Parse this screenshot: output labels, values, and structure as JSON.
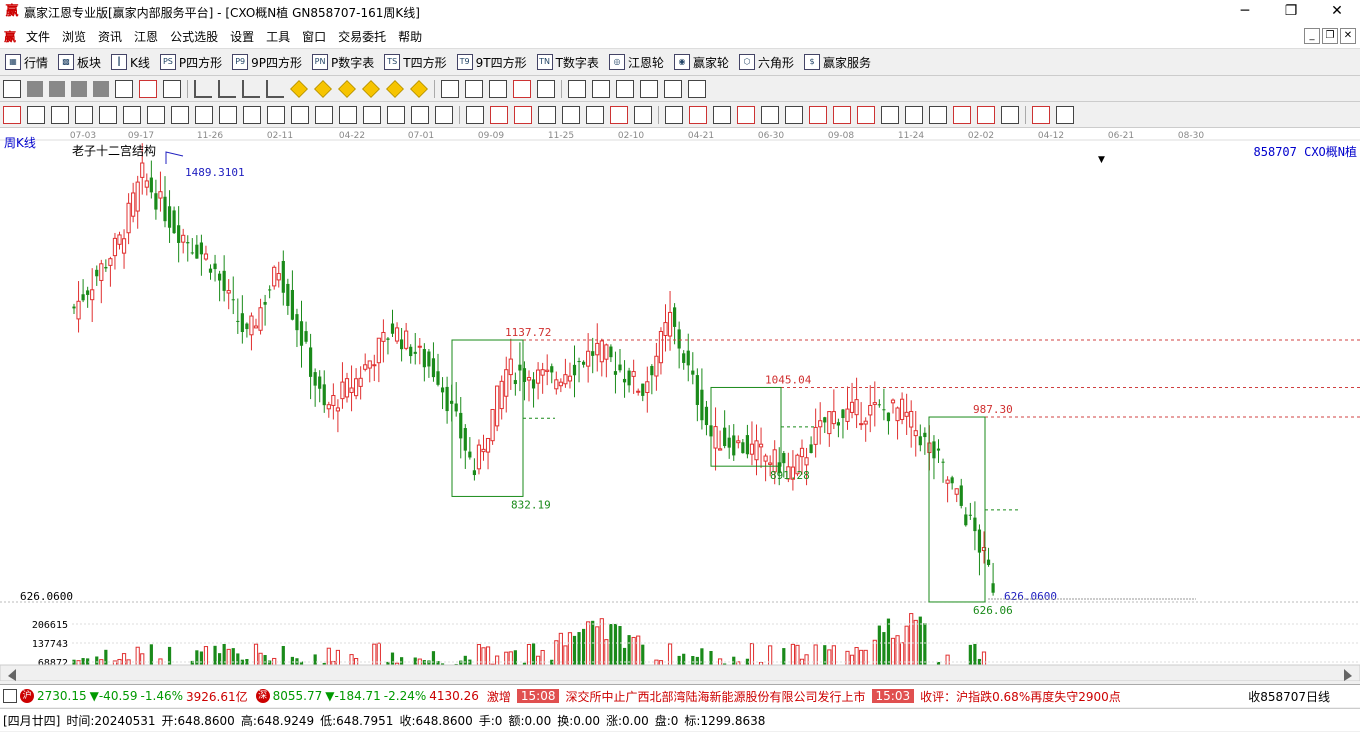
{
  "window": {
    "title": "赢家江恩专业版[赢家内部服务平台] - [CXO概N植  GN858707-161周K线]",
    "app_icon_label": "赢",
    "minimize": "─",
    "restore": "❐",
    "close": "✕"
  },
  "menu": {
    "items": [
      "文件",
      "浏览",
      "资讯",
      "江恩",
      "公式选股",
      "设置",
      "工具",
      "窗口",
      "交易委托",
      "帮助"
    ]
  },
  "toolbar1": {
    "items": [
      {
        "icon": "grid-icon",
        "label": "行情"
      },
      {
        "icon": "blocks-icon",
        "label": "板块"
      },
      {
        "icon": "candle-icon",
        "label": "K线"
      },
      {
        "icon": "ps-icon",
        "label": "P四方形"
      },
      {
        "icon": "p9-icon",
        "label": "9P四方形"
      },
      {
        "icon": "pn-icon",
        "label": "P数字表"
      },
      {
        "icon": "ts-icon",
        "label": "T四方形"
      },
      {
        "icon": "t9-icon",
        "label": "9T四方形"
      },
      {
        "icon": "tn-icon",
        "label": "T数字表"
      },
      {
        "icon": "wheel-icon",
        "label": "江恩轮"
      },
      {
        "icon": "wheel2-icon",
        "label": "赢家轮"
      },
      {
        "icon": "hexagon-icon",
        "label": "六角形"
      },
      {
        "icon": "dollar-icon",
        "label": "赢家服务"
      }
    ]
  },
  "chart": {
    "period_label": "周K线",
    "indicator_name": "老子十二宫结构",
    "code_label": "858707 CXO概N植",
    "dropdown_marker": "▼",
    "date_ticks": [
      "07-03",
      "09-17",
      "11-26",
      "02-11",
      "04-22",
      "07-01",
      "09-09",
      "11-25",
      "02-10",
      "04-21",
      "06-30",
      "09-08",
      "11-24",
      "02-02",
      "04-12",
      "06-21",
      "08-30"
    ],
    "price_labels": {
      "high": "1489.3101",
      "p1137": "1137.72",
      "p1045": "1045.04",
      "p987": "987.30",
      "p891": "891.28",
      "p832": "832.19",
      "low_right": "626.0600",
      "low_box": "626.06",
      "left_axis": "626.0600"
    },
    "volume_axis": [
      "206615",
      "137743",
      "68872"
    ]
  },
  "chart_data": {
    "type": "candlestick",
    "title": "老子十二宫结构",
    "series": [
      {
        "name": "858707 CXO概N植"
      }
    ],
    "x": [
      "07-03",
      "09-17",
      "11-26",
      "02-11",
      "04-22",
      "07-01",
      "09-09",
      "11-25",
      "02-10",
      "04-21",
      "06-30",
      "09-08",
      "11-24",
      "02-02",
      "04-12",
      "06-21",
      "08-30"
    ],
    "annotations": [
      {
        "label": "1489.3101",
        "value": 1489.3101
      },
      {
        "label": "1137.72",
        "value": 1137.72
      },
      {
        "label": "1045.04",
        "value": 1045.04
      },
      {
        "label": "987.30",
        "value": 987.3
      },
      {
        "label": "891.28",
        "value": 891.28
      },
      {
        "label": "832.19",
        "value": 832.19
      },
      {
        "label": "626.06",
        "value": 626.06
      }
    ],
    "ylim": [
      580,
      1540
    ],
    "volume_ticks": [
      206615,
      137743,
      68872
    ]
  },
  "statusbar": {
    "sh": {
      "badge": "沪",
      "value": "2730.15",
      "chg": "▼-40.59",
      "pct": "-1.46%",
      "amt": "3926.61亿"
    },
    "sz": {
      "badge": "深",
      "value": "8055.77",
      "chg": "▼-184.71",
      "pct": "-2.24%",
      "amt": "4130.26"
    },
    "news": [
      {
        "text": "激增"
      },
      {
        "time": "15:08",
        "text": "深交所中止广西北部湾陆海新能源股份有限公司发行上市"
      },
      {
        "time": "15:03",
        "text": "收评：沪指跌0.68%再度失守2900点"
      }
    ],
    "right": "收858707日线"
  },
  "infobar": {
    "date": "[四月廿四]",
    "time": "时间:20240531",
    "open": "开:648.8600",
    "high": "高:648.9249",
    "low": "低:648.7951",
    "close": "收:648.8600",
    "hand": "手:0",
    "amount": "额:0.00",
    "turnover": "换:0.00",
    "rise": "涨:0.00",
    "pan": "盘:0",
    "mark": "标:1299.8638"
  }
}
